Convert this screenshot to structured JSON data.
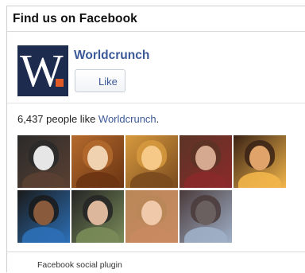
{
  "header": {
    "title": "Find us on Facebook"
  },
  "page": {
    "name": "Worldcrunch",
    "logo_letter": "W",
    "logo_colors": {
      "background": "#1d2b4e",
      "letter": "#ffffff",
      "accent": "#e05a26"
    },
    "like_button_label": "Like"
  },
  "likes": {
    "prefix": "6,437 people like ",
    "page_link": "Worldcrunch",
    "suffix": "."
  },
  "fans": [
    {
      "name": "fan-1",
      "colors": [
        "#2a2a2a",
        "#e6e6e6",
        "#5a4032"
      ]
    },
    {
      "name": "fan-2",
      "colors": [
        "#b46a2d",
        "#f0d2b0",
        "#6b3412"
      ]
    },
    {
      "name": "fan-3",
      "colors": [
        "#d79a3e",
        "#f6c988",
        "#7a4a1e"
      ]
    },
    {
      "name": "fan-4",
      "colors": [
        "#5b3426",
        "#d5a98f",
        "#8b2a2a"
      ]
    },
    {
      "name": "fan-5",
      "colors": [
        "#3a2215",
        "#e0a46b",
        "#f2b64a"
      ]
    },
    {
      "name": "fan-6",
      "colors": [
        "#1a1a1a",
        "#8a5a3c",
        "#2c6fb6"
      ]
    },
    {
      "name": "fan-7",
      "colors": [
        "#242424",
        "#dcb79b",
        "#7a8c59"
      ]
    },
    {
      "name": "fan-8",
      "colors": [
        "#b98758",
        "#f0c8aa",
        "#c98a62"
      ]
    },
    {
      "name": "fan-9",
      "colors": [
        "#4a3a3a",
        "#6a6060",
        "#9fb0c8"
      ]
    }
  ],
  "footer": {
    "text": "Facebook social plugin"
  }
}
